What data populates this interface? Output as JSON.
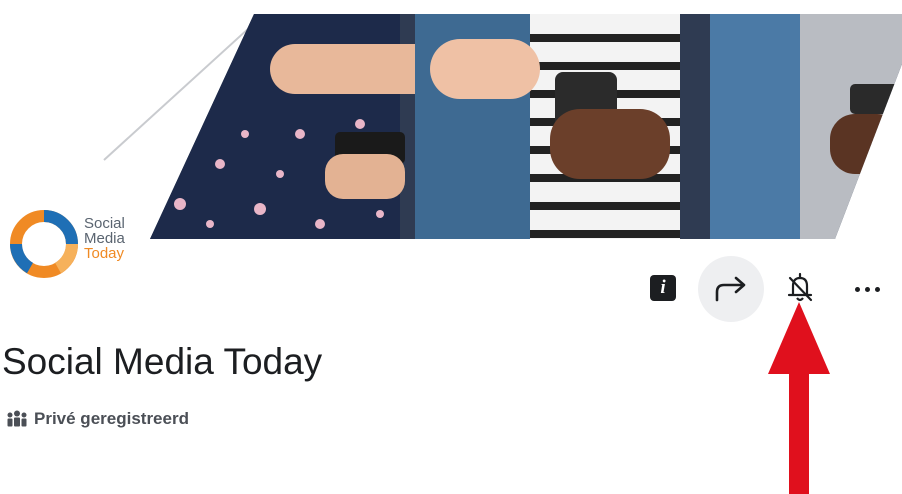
{
  "group": {
    "name": "Social Media Today",
    "privacy_label": "Privé geregistreerd"
  },
  "logo": {
    "lines": [
      "Social",
      "Media",
      "Today"
    ]
  },
  "actions": {
    "info_icon": "info-icon",
    "share_icon": "share-icon",
    "notifications_icon": "bell-off-icon",
    "more_icon": "more-icon"
  },
  "colors": {
    "text_primary": "#1c1e21",
    "text_secondary": "#4b4f56",
    "highlight_arrow": "#e0101d",
    "logo_orange": "#f08a24",
    "logo_blue": "#1f6fb5"
  }
}
